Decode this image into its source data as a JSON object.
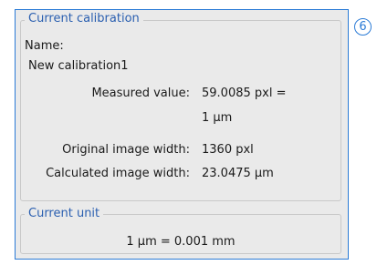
{
  "calibration": {
    "group_title": "Current calibration",
    "name_label": "Name:",
    "name_value": "New calibration1",
    "measured_label": "Measured value:",
    "measured_value_line1": "59.0085 pxl =",
    "measured_value_line2": "1 µm",
    "original_width_label": "Original image width:",
    "original_width_value": "1360 pxl",
    "calculated_width_label": "Calculated image width:",
    "calculated_width_value": "23.0475 µm"
  },
  "unit": {
    "group_title": "Current unit",
    "value": "1 µm = 0.001 mm"
  },
  "badge": {
    "label": "6"
  },
  "colors": {
    "accent": "#2b7bd6",
    "legend_text": "#2a5fb0",
    "panel_bg": "#eaeaea"
  }
}
